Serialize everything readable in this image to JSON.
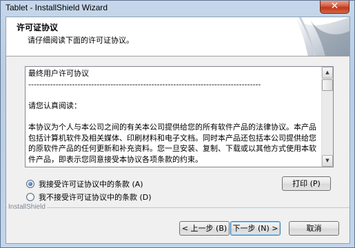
{
  "window": {
    "title": "Tablet - InstallShield Wizard",
    "close_glyph": "✕"
  },
  "header": {
    "title": "许可证协议",
    "subtitle": "请仔细阅读下面的许可证协议。"
  },
  "license": {
    "text": "最终用户许可协议\n-------------------------------------------------------------------------------------\n\n请您认真阅读：\n\n本协议为个人与本公司之间的有关本公司提供给您的所有软件产品的法律协议。本产品包括计算机软件及相关媒体、印刷材料和电子文档。同时本产品还包括本公司提供给您的原软件产品的任何更新和补充资料。您一旦安装、复制、下载或以其他方式使用本软件产品，即表示您同意接受本协议各项条款的约束。"
  },
  "radios": {
    "accept": {
      "label": "我接受许可证协议中的条款 (A)",
      "checked": true
    },
    "decline": {
      "label": "我不接受许可证协议中的条款 (D)",
      "checked": false
    }
  },
  "buttons": {
    "print": "打印 (P)",
    "back": "< 上一步 (B)",
    "next": "下一步 (N) >",
    "cancel": "取消"
  },
  "brand": "InstallShield",
  "colors": {
    "title_bar": "#b9cde4",
    "close_button": "#c94a2c",
    "dialog_bg": "#f0f0f0",
    "default_button_border": "#3c7fb1"
  },
  "icons": {
    "scroll_up": "▲",
    "scroll_down": "▼"
  }
}
